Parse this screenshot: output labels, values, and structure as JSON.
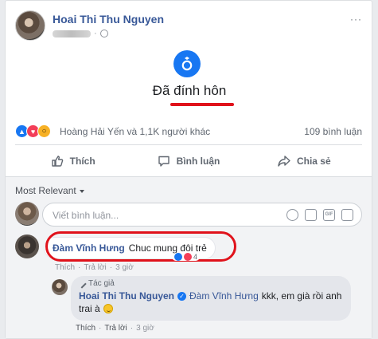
{
  "post": {
    "author": "Hoai Thi Thu Nguyen",
    "meta_separator": "·",
    "more": "···"
  },
  "event": {
    "title": "Đã đính hôn"
  },
  "reactions": {
    "summary": "Hoàng Hải Yến và 1,1K người khác",
    "comments": "109 bình luận"
  },
  "actions": {
    "like": "Thích",
    "comment": "Bình luận",
    "share": "Chia sẻ"
  },
  "comments": {
    "sort": "Most Relevant",
    "composer_placeholder": "Viết bình luận...",
    "gif_label": "GIF",
    "first": {
      "name": "Đàm Vĩnh Hưng",
      "text": "Chuc mung đôi trẻ",
      "reaction_count": "4",
      "actions": [
        "Thích",
        "·",
        "Trả lời",
        "·",
        "3 giờ"
      ]
    },
    "reply": {
      "badge": "Tác giả",
      "name": "Hoai Thi Thu Nguyen",
      "tag": "Đàm Vĩnh Hưng",
      "text1": "kkk, em già rồi anh",
      "text2": "trai à",
      "actions": [
        "Thích",
        "·",
        "Trả lời",
        "·",
        "3 giờ"
      ]
    }
  },
  "colors": {
    "link": "#385898",
    "accent": "#1877f2",
    "annotation_red": "#e0121b"
  }
}
